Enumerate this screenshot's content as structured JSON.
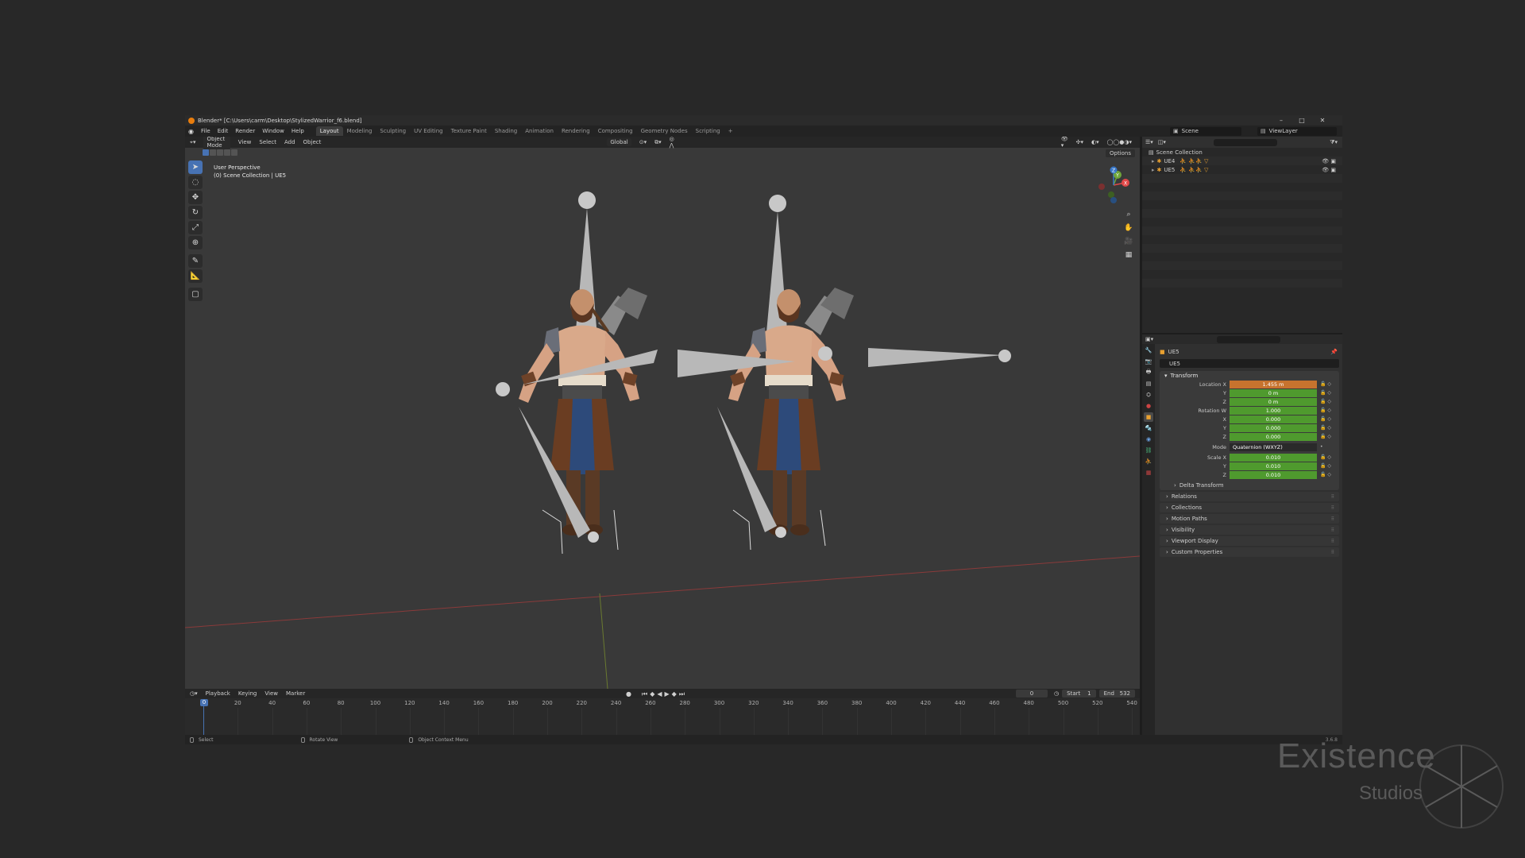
{
  "window": {
    "title": "Blender* [C:\\Users\\carm\\Desktop\\StylizedWarrior_f6.blend]",
    "minimize": "–",
    "maximize": "□",
    "close": "✕"
  },
  "menu": {
    "items": [
      "File",
      "Edit",
      "Render",
      "Window",
      "Help"
    ],
    "workspaces": [
      "Layout",
      "Modeling",
      "Sculpting",
      "UV Editing",
      "Texture Paint",
      "Shading",
      "Animation",
      "Rendering",
      "Compositing",
      "Geometry Nodes",
      "Scripting"
    ],
    "add_workspace": "+",
    "scene": "Scene",
    "view_layer": "ViewLayer"
  },
  "viewport": {
    "mode": "Object Mode",
    "menus": [
      "View",
      "Select",
      "Add",
      "Object"
    ],
    "transform_orientation": "Global",
    "info_line1": "User Perspective",
    "info_line2": "(0) Scene Collection | UE5",
    "options": "Options",
    "gizmo_labels": {
      "x": "X",
      "y": "Y",
      "z": "Z"
    }
  },
  "tools": [
    "select-box",
    "cursor",
    "move",
    "rotate",
    "scale",
    "transform",
    "annotate",
    "measure",
    "add-cube"
  ],
  "timeline": {
    "menus": [
      "Playback",
      "Keying",
      "View",
      "Marker"
    ],
    "current_frame": "0",
    "start_label": "Start",
    "start": "1",
    "end_label": "End",
    "end": "532",
    "playhead": "0",
    "ticks": [
      "20",
      "40",
      "60",
      "80",
      "100",
      "120",
      "140",
      "160",
      "180",
      "200",
      "220",
      "240",
      "260",
      "280",
      "300",
      "320",
      "340",
      "360",
      "380",
      "400",
      "420",
      "440",
      "460",
      "480",
      "500",
      "520",
      "540"
    ]
  },
  "status": {
    "select": "Select",
    "rotate": "Rotate View",
    "context": "Object Context Menu",
    "version": "3.6.8"
  },
  "outliner": {
    "root": "Scene Collection",
    "objects": [
      "UE4",
      "UE5"
    ]
  },
  "properties": {
    "object_name": "UE5",
    "object_field": "UE5",
    "transform": {
      "title": "Transform",
      "location_label": "Location X",
      "location": [
        "1.455 m",
        "0 m",
        "0 m"
      ],
      "rotation_label": "Rotation W",
      "rotation": [
        "1.000",
        "0.000",
        "0.000",
        "0.000"
      ],
      "mode_label": "Mode",
      "mode": "Quaternion (WXYZ)",
      "scale_label": "Scale X",
      "scale": [
        "0.010",
        "0.010",
        "0.010"
      ],
      "axis_y": "Y",
      "axis_z": "Z",
      "axis_x": "X"
    },
    "panels": [
      "Delta Transform",
      "Relations",
      "Collections",
      "Motion Paths",
      "Visibility",
      "Viewport Display",
      "Custom Properties"
    ]
  },
  "watermark": {
    "main": "Existence",
    "sub": "Studios"
  },
  "colors": {
    "accent": "#4772b3",
    "location_field": "#c7732e",
    "animated_field": "#4f9a2e",
    "armature": "#e8a030"
  }
}
